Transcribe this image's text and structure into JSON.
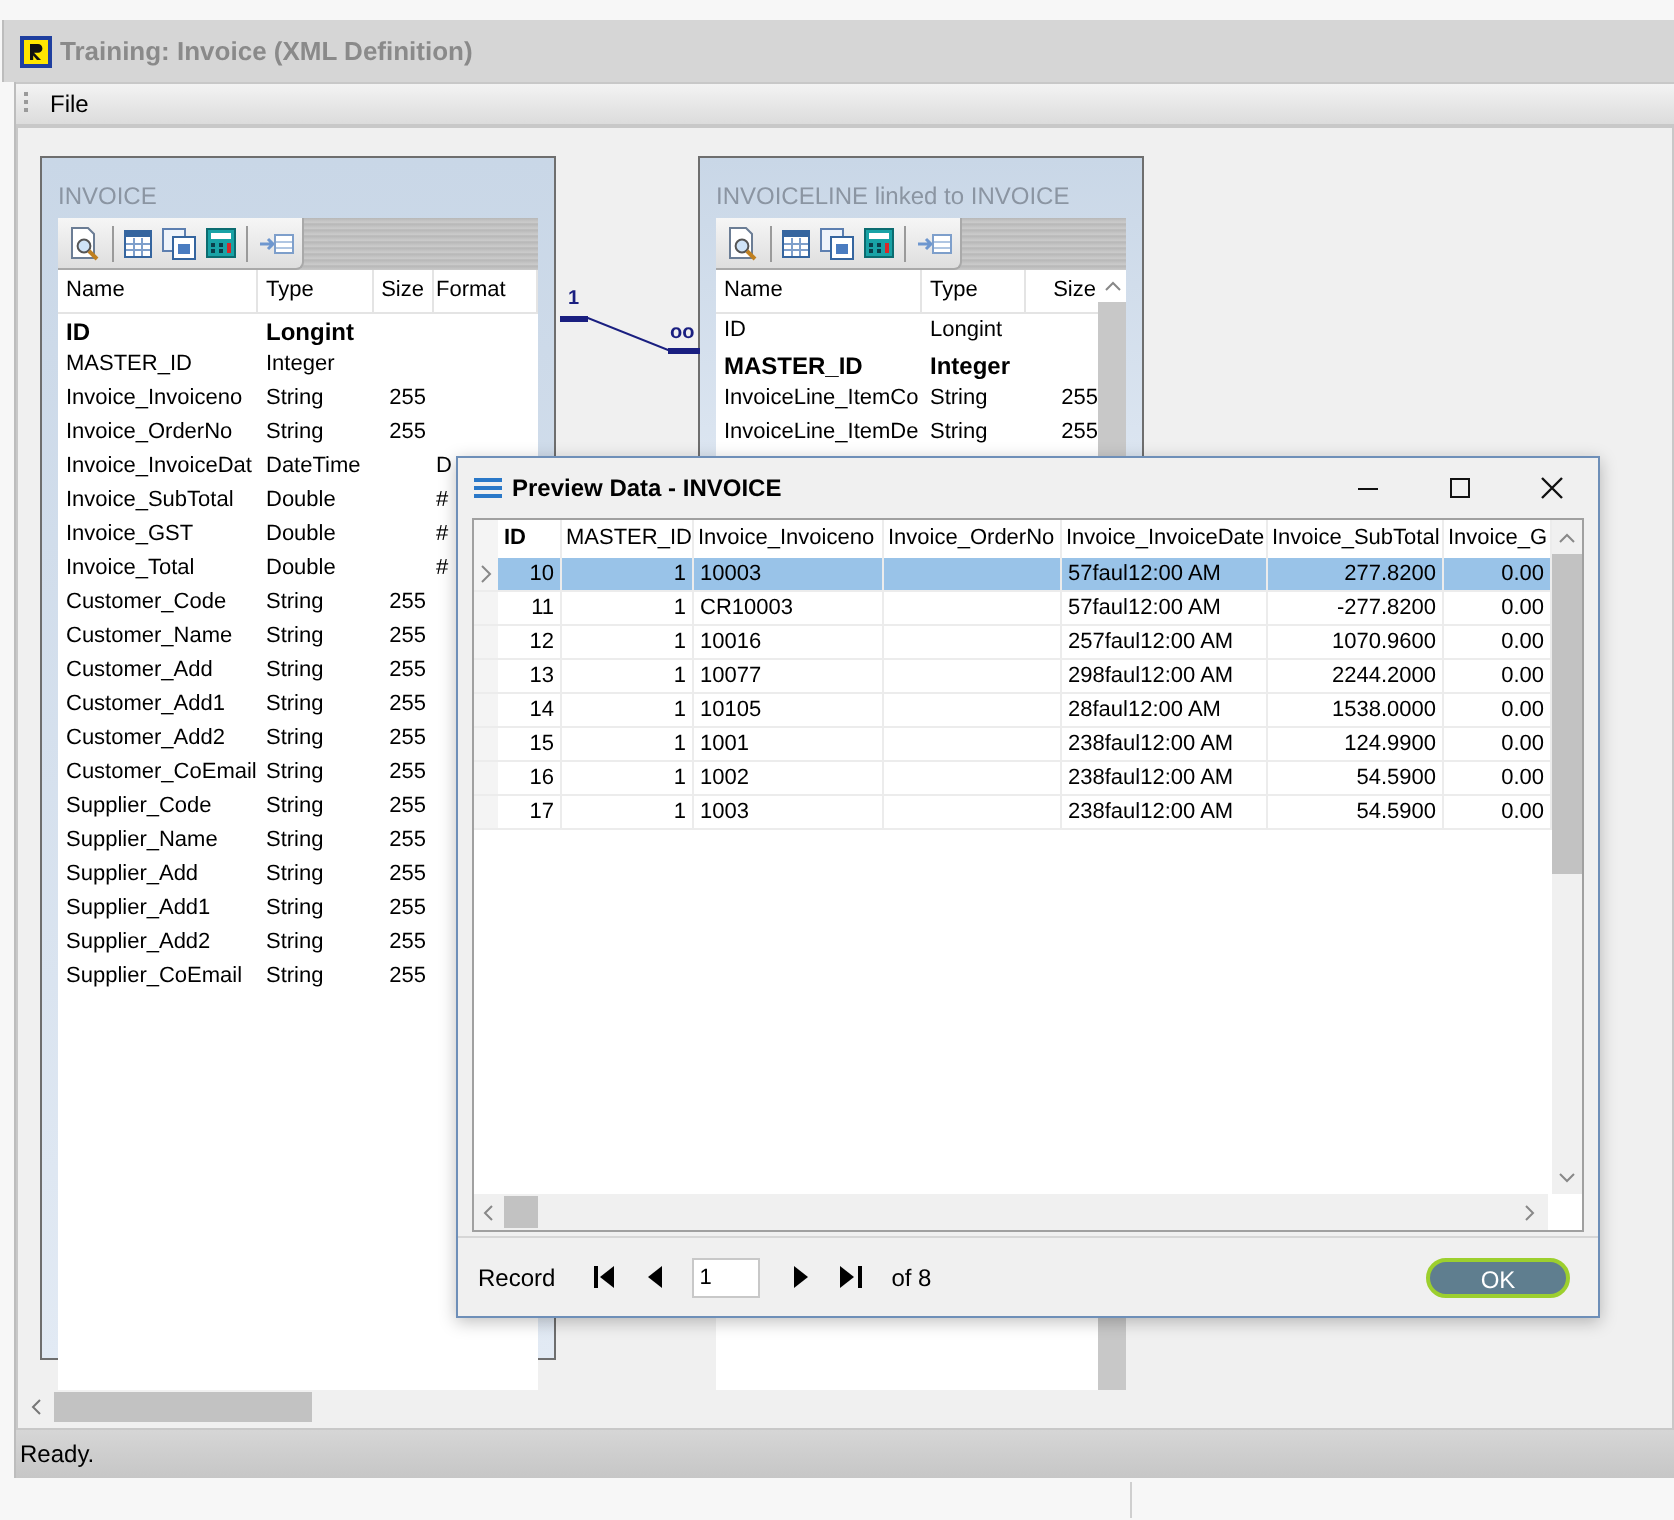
{
  "window": {
    "title": "Training: Invoice (XML Definition)"
  },
  "menu": [
    {
      "label": "File"
    }
  ],
  "tables": [
    {
      "title": "INVOICE",
      "columns": [
        "Name",
        "Type",
        "Size",
        "Format"
      ],
      "rows": [
        {
          "name": "ID",
          "type": "Longint",
          "size": "",
          "format": "",
          "bold": true
        },
        {
          "name": "MASTER_ID",
          "type": "Integer",
          "size": "",
          "format": "",
          "bold": false
        },
        {
          "name": "Invoice_Invoiceno",
          "type": "String",
          "size": "255",
          "format": "",
          "bold": false
        },
        {
          "name": "Invoice_OrderNo",
          "type": "String",
          "size": "255",
          "format": "",
          "bold": false
        },
        {
          "name": "Invoice_InvoiceDat",
          "type": "DateTime",
          "size": "",
          "format": "D",
          "bold": false
        },
        {
          "name": "Invoice_SubTotal",
          "type": "Double",
          "size": "",
          "format": "#",
          "bold": false
        },
        {
          "name": "Invoice_GST",
          "type": "Double",
          "size": "",
          "format": "#",
          "bold": false
        },
        {
          "name": "Invoice_Total",
          "type": "Double",
          "size": "",
          "format": "#",
          "bold": false
        },
        {
          "name": "Customer_Code",
          "type": "String",
          "size": "255",
          "format": "",
          "bold": false
        },
        {
          "name": "Customer_Name",
          "type": "String",
          "size": "255",
          "format": "",
          "bold": false
        },
        {
          "name": "Customer_Add",
          "type": "String",
          "size": "255",
          "format": "",
          "bold": false
        },
        {
          "name": "Customer_Add1",
          "type": "String",
          "size": "255",
          "format": "",
          "bold": false
        },
        {
          "name": "Customer_Add2",
          "type": "String",
          "size": "255",
          "format": "",
          "bold": false
        },
        {
          "name": "Customer_CoEmail",
          "type": "String",
          "size": "255",
          "format": "",
          "bold": false
        },
        {
          "name": "Supplier_Code",
          "type": "String",
          "size": "255",
          "format": "",
          "bold": false
        },
        {
          "name": "Supplier_Name",
          "type": "String",
          "size": "255",
          "format": "",
          "bold": false
        },
        {
          "name": "Supplier_Add",
          "type": "String",
          "size": "255",
          "format": "",
          "bold": false
        },
        {
          "name": "Supplier_Add1",
          "type": "String",
          "size": "255",
          "format": "",
          "bold": false
        },
        {
          "name": "Supplier_Add2",
          "type": "String",
          "size": "255",
          "format": "",
          "bold": false
        },
        {
          "name": "Supplier_CoEmail",
          "type": "String",
          "size": "255",
          "format": "",
          "bold": false
        }
      ]
    },
    {
      "title": "INVOICELINE linked to INVOICE",
      "columns": [
        "Name",
        "Type",
        "Size"
      ],
      "rows": [
        {
          "name": "ID",
          "type": "Longint",
          "size": "",
          "format": "",
          "bold": false
        },
        {
          "name": "MASTER_ID",
          "type": "Integer",
          "size": "",
          "format": "",
          "bold": true
        },
        {
          "name": "InvoiceLine_ItemCo",
          "type": "String",
          "size": "255",
          "format": "",
          "bold": false
        },
        {
          "name": "InvoiceLine_ItemDe",
          "type": "String",
          "size": "255",
          "format": "",
          "bold": false
        }
      ]
    }
  ],
  "relation": {
    "from_label": "1",
    "to_label": "oo"
  },
  "preview": {
    "title": "Preview Data - INVOICE",
    "columns": [
      "ID",
      "MASTER_ID",
      "Invoice_Invoiceno",
      "Invoice_OrderNo",
      "Invoice_InvoiceDate",
      "Invoice_SubTotal",
      "Invoice_G"
    ],
    "rows": [
      {
        "selected": true,
        "cells": [
          "10",
          "1",
          "10003",
          "",
          "57faul12:00 AM",
          "277.8200",
          "0.00"
        ]
      },
      {
        "selected": false,
        "cells": [
          "11",
          "1",
          "CR10003",
          "",
          "57faul12:00 AM",
          "-277.8200",
          "0.00"
        ]
      },
      {
        "selected": false,
        "cells": [
          "12",
          "1",
          "10016",
          "",
          "257faul12:00 AM",
          "1070.9600",
          "0.00"
        ]
      },
      {
        "selected": false,
        "cells": [
          "13",
          "1",
          "10077",
          "",
          "298faul12:00 AM",
          "2244.2000",
          "0.00"
        ]
      },
      {
        "selected": false,
        "cells": [
          "14",
          "1",
          "10105",
          "",
          "28faul12:00 AM",
          "1538.0000",
          "0.00"
        ]
      },
      {
        "selected": false,
        "cells": [
          "15",
          "1",
          "1001",
          "",
          "238faul12:00 AM",
          "124.9900",
          "0.00"
        ]
      },
      {
        "selected": false,
        "cells": [
          "16",
          "1",
          "1002",
          "",
          "238faul12:00 AM",
          "54.5900",
          "0.00"
        ]
      },
      {
        "selected": false,
        "cells": [
          "17",
          "1",
          "1003",
          "",
          "238faul12:00 AM",
          "54.5900",
          "0.00"
        ]
      }
    ],
    "record_label": "Record",
    "record_value": "1",
    "record_total": "of 8",
    "ok_label": "OK"
  },
  "status_bar": {
    "text": "Ready."
  }
}
